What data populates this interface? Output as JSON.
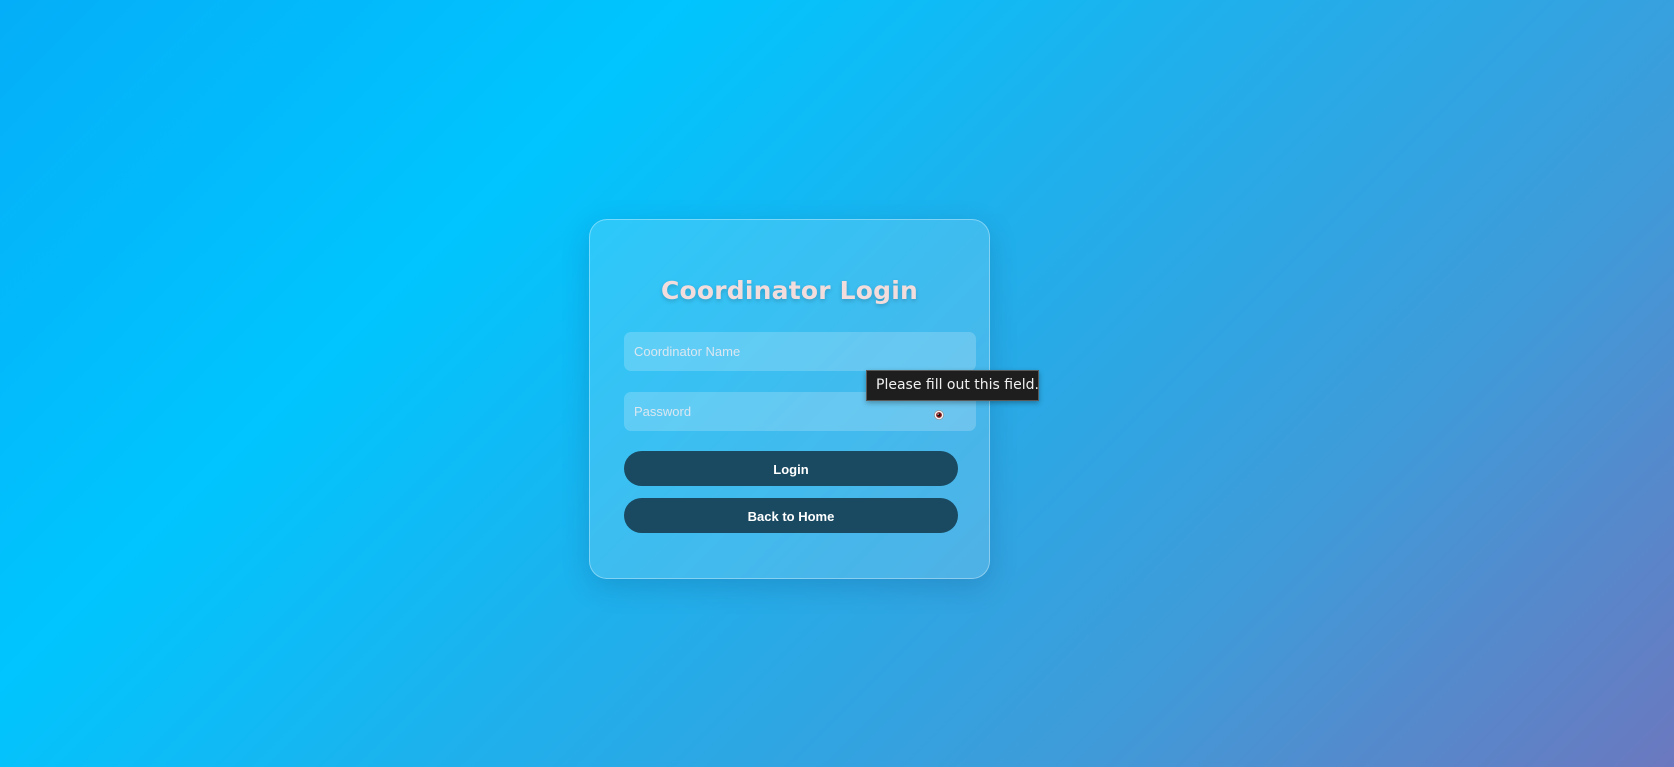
{
  "login_card": {
    "title": "Coordinator Login",
    "name_field": {
      "placeholder": "Coordinator Name",
      "value": ""
    },
    "password_field": {
      "placeholder": "Password",
      "value": "",
      "toggle_icon": "eye-icon"
    },
    "login_button": "Login",
    "home_button": "Back to Home"
  },
  "validation_tooltip": {
    "message": "Please fill out this field."
  },
  "colors": {
    "background_start": "#05aef8",
    "background_end": "#6b78bf",
    "button": "#1a4a62",
    "title": "#f2dcdc"
  }
}
